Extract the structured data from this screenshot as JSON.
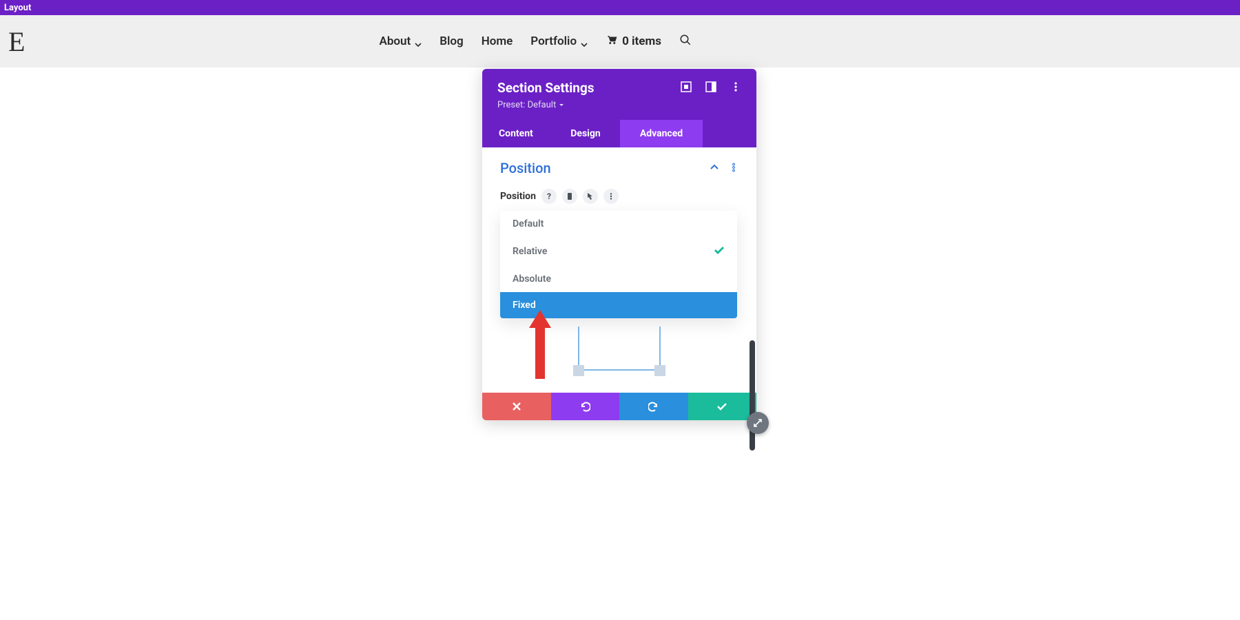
{
  "topbar": {
    "title": "Layout"
  },
  "nav": {
    "logo": "E",
    "items": {
      "about": {
        "label": "About",
        "has_submenu": true
      },
      "blog": {
        "label": "Blog",
        "has_submenu": false
      },
      "home": {
        "label": "Home",
        "has_submenu": false
      },
      "portfolio": {
        "label": "Portfolio",
        "has_submenu": true
      },
      "cart": {
        "label": "0 items"
      }
    }
  },
  "modal": {
    "title": "Section Settings",
    "preset_label": "Preset: Default",
    "tabs": {
      "content": "Content",
      "design": "Design",
      "advanced": "Advanced",
      "active": "advanced"
    },
    "section": {
      "title": "Position",
      "field_label": "Position"
    },
    "position_options": [
      {
        "label": "Default",
        "selected": false,
        "highlighted": false
      },
      {
        "label": "Relative",
        "selected": true,
        "highlighted": false
      },
      {
        "label": "Absolute",
        "selected": false,
        "highlighted": false
      },
      {
        "label": "Fixed",
        "selected": false,
        "highlighted": true
      }
    ]
  },
  "colors": {
    "purple": "#6b20c6",
    "purple_light": "#8e3cf0",
    "blue": "#2a8fdc",
    "teal": "#1abc9c",
    "red": "#e86060",
    "annotation": "#e3342f"
  }
}
